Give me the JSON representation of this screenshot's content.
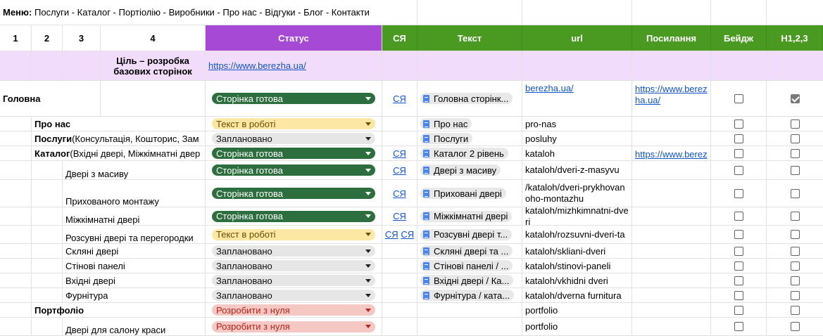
{
  "menu": {
    "label": "Меню:",
    "text": "Послуги - Каталог - Портіолію - Виробники - Про нас - Відгуки - Блог - Контакти"
  },
  "headers": {
    "c1": "1",
    "c2": "2",
    "c3": "3",
    "c4": "4",
    "status": "Статус",
    "sya": "СЯ",
    "text": "Текст",
    "url": "url",
    "link": "Посилання",
    "badge": "Бейдж",
    "h123": "H1,2,3"
  },
  "goal": {
    "text": "Ціль – розробка базових сторінок",
    "url": "https://www.berezha.ua/"
  },
  "rows": [
    {
      "label": "Головна",
      "status": "Сторінка готова",
      "sya": "СЯ",
      "doc": "Головна сторінк...",
      "url": "berezha.ua/",
      "link": "https://www.berezha.ua/",
      "badge": false,
      "h": true
    },
    {
      "label": "Про нас",
      "status": "Текст в роботі",
      "doc": "Про нас",
      "url": "pro-nas",
      "badge": false,
      "h": false
    },
    {
      "label": "Послуги",
      "label_rest": " (Консультація, Кошторис, Зам",
      "status": "Заплановано",
      "doc": "Послуги",
      "url": "posluhy",
      "badge": false,
      "h": false
    },
    {
      "label": "Каталог",
      "label_rest": " (Вхідні двері, Міжкімнатні двер",
      "status": "Сторінка готова",
      "sya": "СЯ",
      "doc": "Каталог 2 рівень",
      "url": "kataloh",
      "link": "https://www.berezh",
      "badge": false,
      "h": false
    },
    {
      "label": "Двері з масиву",
      "status": "Сторінка готова",
      "sya": "СЯ",
      "doc": "Двері з масиву",
      "url": "kataloh/dveri-z-masyvu",
      "badge": false,
      "h": false
    },
    {
      "label": "Прихованого монтажу",
      "status": "Сторінка готова",
      "sya": "СЯ",
      "doc": "Приховані двері",
      "url": "/kataloh/dveri-prykhovanoho-montazhu",
      "badge": false,
      "h": false
    },
    {
      "label": "Міжкімнатні двері",
      "status": "Сторінка готова",
      "sya": "СЯ",
      "doc": "Міжкімнатні двері",
      "url": "kataloh/mizhkimnatni-dveri",
      "badge": false,
      "h": false
    },
    {
      "label": "Розсувні двері та перегородки",
      "status": "Текст в роботі",
      "sya": "СЯ",
      "sya2": "СЯ",
      "doc": "Розсувні двері т...",
      "url": "kataloh/rozsuvni-dveri-ta",
      "badge": false,
      "h": false
    },
    {
      "label": "Скляні двері",
      "status": "Заплановано",
      "doc": "Скляні двері та ...",
      "url": "kataloh/skliani-dveri",
      "badge": false,
      "h": false
    },
    {
      "label": "Стінові панелі",
      "status": "Заплановано",
      "doc": "Стінові панелі / ...",
      "url": "kataloh/stinovi-paneli",
      "badge": false,
      "h": false
    },
    {
      "label": "Вхідні двері",
      "status": "Заплановано",
      "doc": "Вхідні двері / Ка...",
      "url": "kataloh/vkhidni dveri",
      "badge": false,
      "h": false
    },
    {
      "label": "Фурнітура",
      "status": "Заплановано",
      "doc": "Фурнітура / ката...",
      "url": "kataloh/dverna furnitura",
      "badge": false,
      "h": false
    },
    {
      "label": "Портфоліо",
      "status": "Розробити з нуля",
      "url": "portfolio",
      "badge": false,
      "h": false
    },
    {
      "label": "Двері для салону краси",
      "status": "Розробити з нуля",
      "url": "portfolio",
      "badge": false,
      "h": false
    }
  ],
  "colors": {
    "green_header": "#4a9a22",
    "purple_header": "#a64ad6",
    "purple_row": "#f1dcfb",
    "chip_green": "#2d6e3e",
    "chip_yellow": "#fde7a4",
    "chip_gray": "#e6e6e6",
    "chip_red": "#f6c8c3",
    "link": "#1155cc"
  }
}
